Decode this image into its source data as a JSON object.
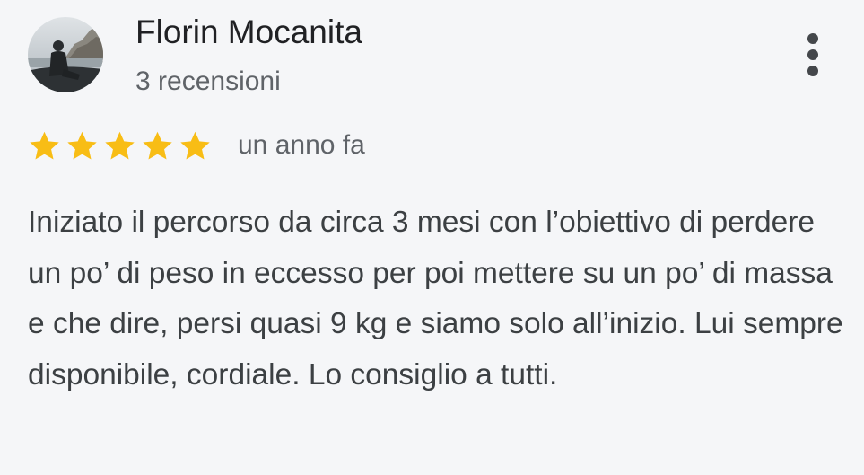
{
  "review": {
    "author_name": "Florin Mocanita",
    "author_meta": "3 recensioni",
    "rating": 5,
    "rating_max": 5,
    "date": "un anno fa",
    "text": "Iniziato il percorso da circa 3 mesi con l’obiettivo di perdere un po’ di peso in eccesso per poi mettere su un po’ di massa e che dire, persi quasi 9 kg e siamo solo all’inizio. Lui sempre disponibile, cordiale. Lo consiglio a tutti."
  },
  "icons": {
    "star": "star-icon",
    "more": "more-vert-icon",
    "avatar": "avatar-photo"
  },
  "colors": {
    "star": "#f8bd15",
    "background": "#f5f6f8",
    "name": "#202124",
    "secondary": "#5f6368",
    "body_text": "#3c4043"
  }
}
